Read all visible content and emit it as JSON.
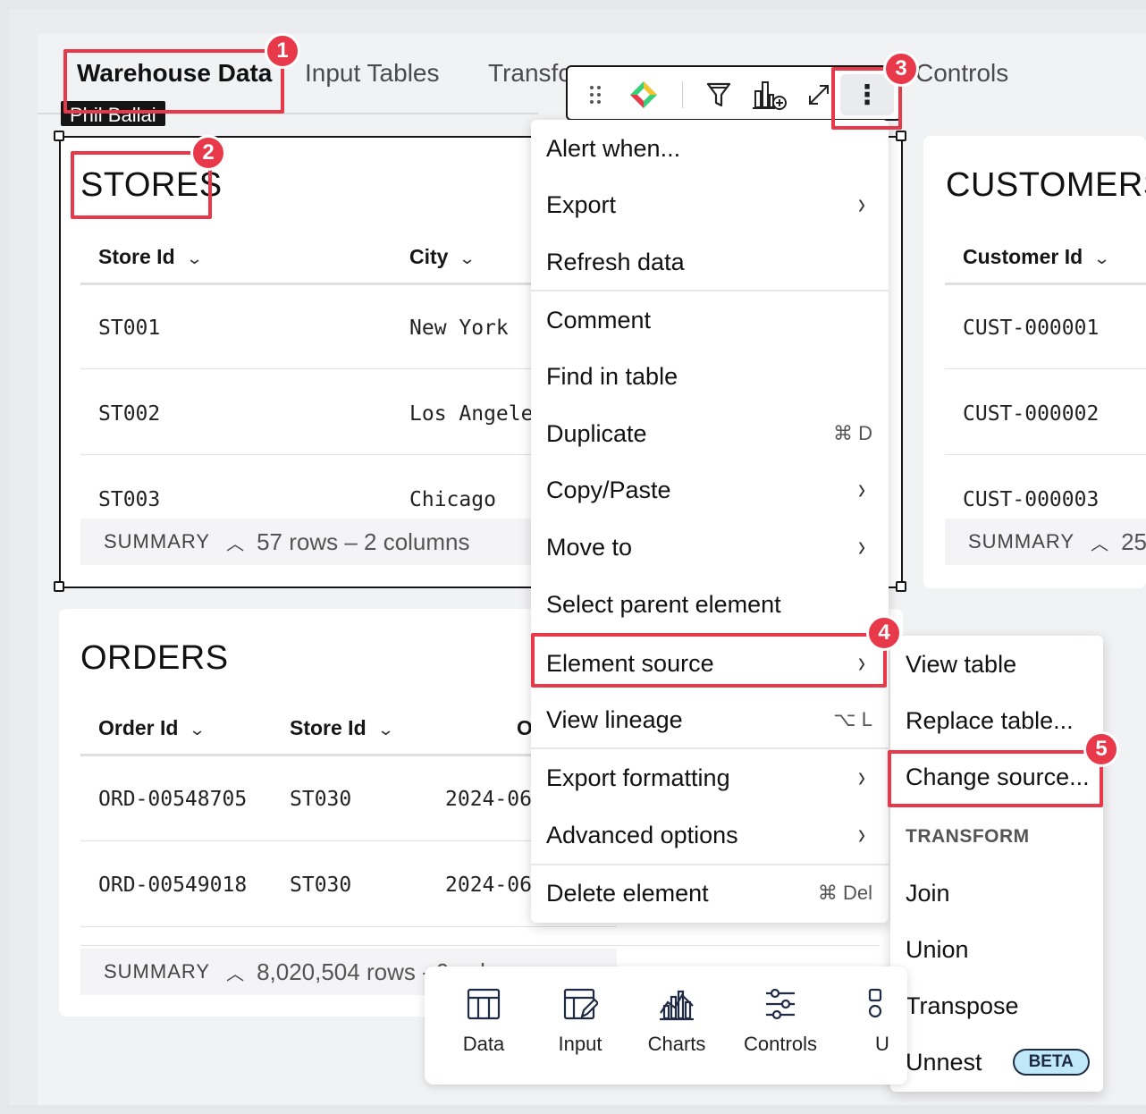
{
  "tabs": [
    "Warehouse Data",
    "Input Tables",
    "Transfo",
    "Controls"
  ],
  "name_tag": "Phil Ballai",
  "stores": {
    "title": "STORES",
    "columns": [
      "Store Id",
      "City"
    ],
    "rows": [
      [
        "ST001",
        "New York"
      ],
      [
        "ST002",
        "Los Angele"
      ],
      [
        "ST003",
        "Chicago"
      ]
    ],
    "summary_label": "SUMMARY",
    "summary_value": "57 rows – 2 columns"
  },
  "customers": {
    "title": "CUSTOMERS",
    "columns": [
      "Customer Id"
    ],
    "rows": [
      [
        "CUST-000001"
      ],
      [
        "CUST-000002"
      ],
      [
        "CUST-000003"
      ]
    ],
    "summary_label": "SUMMARY",
    "summary_value": "25"
  },
  "orders": {
    "title": "ORDERS",
    "columns": [
      "Order Id",
      "Store Id",
      "O"
    ],
    "rows": [
      [
        "ORD-00548705",
        "ST030",
        "2024-06"
      ],
      [
        "ORD-00549018",
        "ST030",
        "2024-06"
      ]
    ],
    "summary_label": "SUMMARY",
    "summary_value": "8,020,504 rows - 9 col"
  },
  "menu": {
    "items": [
      {
        "label": "Alert when..."
      },
      {
        "label": "Export",
        "arrow": "›"
      },
      {
        "label": "Refresh data"
      },
      {
        "label": "Comment"
      },
      {
        "label": "Find in table"
      },
      {
        "label": "Duplicate",
        "shortcut": "⌘ D"
      },
      {
        "label": "Copy/Paste",
        "arrow": "›"
      },
      {
        "label": "Move to",
        "arrow": "›"
      },
      {
        "label": "Select parent element"
      },
      {
        "label": "Element source",
        "arrow": "›"
      },
      {
        "label": "View lineage",
        "shortcut": "⌥ L"
      },
      {
        "label": "Export formatting",
        "arrow": "›"
      },
      {
        "label": "Advanced options",
        "arrow": "›"
      },
      {
        "label": "Delete element",
        "shortcut": "⌘ Del"
      }
    ]
  },
  "submenu": {
    "items": [
      "View table",
      "Replace table...",
      "Change source..."
    ],
    "section": "TRANSFORM",
    "transform_items": [
      "Join",
      "Union",
      "Transpose",
      "Unnest"
    ],
    "beta": "BETA"
  },
  "bottombar": {
    "items": [
      "Data",
      "Input",
      "Charts",
      "Controls",
      "U"
    ]
  },
  "toolbar": {
    "more_glyph": "⋮"
  },
  "callouts": [
    "1",
    "2",
    "3",
    "4",
    "5"
  ],
  "colors": {
    "callout": "#e8394a",
    "beta_bg": "#bfe9f7"
  }
}
